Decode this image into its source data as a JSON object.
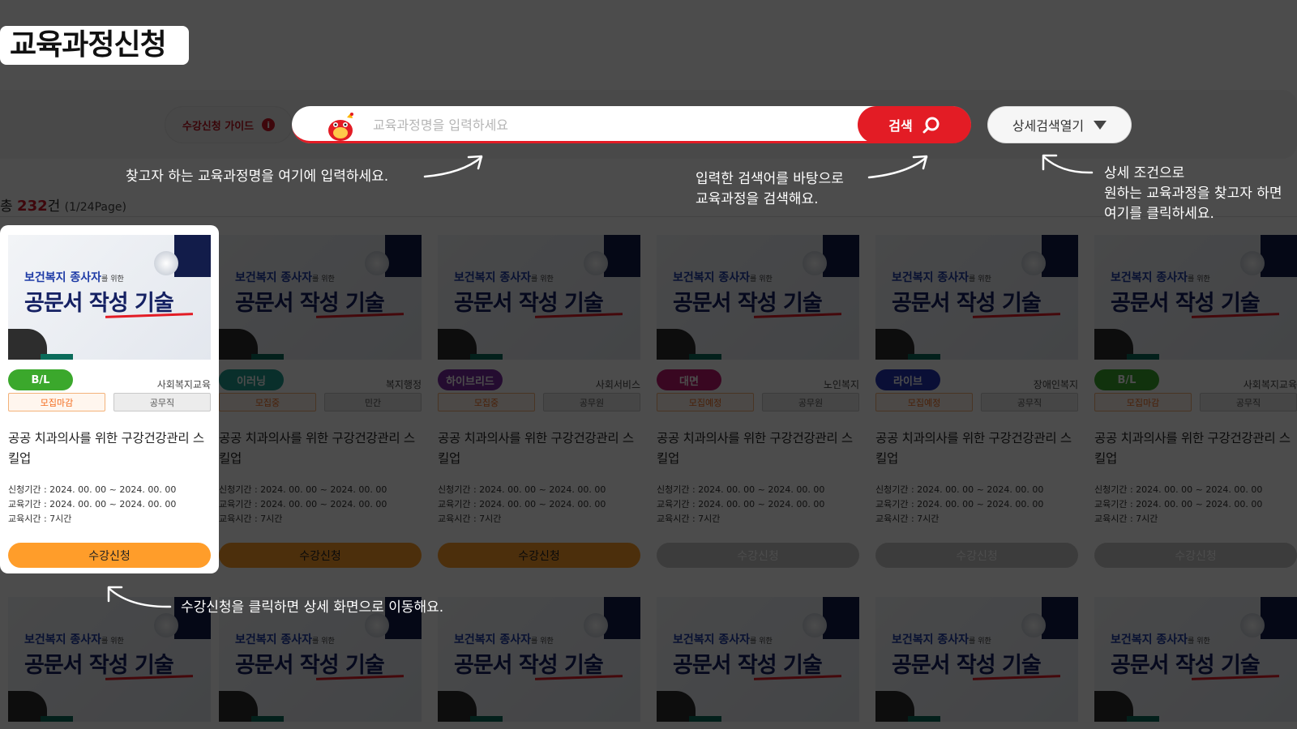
{
  "page": {
    "title": "교육과정신청"
  },
  "search": {
    "guide_label": "수강신청 가이드",
    "info_icon": "i",
    "placeholder": "교육과정명을 입력하세요",
    "search_label": "검색",
    "detail_label": "상세검색열기"
  },
  "results": {
    "prefix": "총",
    "count": "232",
    "unit": "건",
    "page_info": "(1/24Page)"
  },
  "thumbnail": {
    "line1_main": "보건복지 종사자",
    "line1_suffix": "를 위한",
    "line2": "공문서 작성 기술"
  },
  "card_labels": {
    "period_apply": "신청기간 :  2024. 00. 00 ~ 2024. 00. 00",
    "period_edu": "교육기간 :  2024. 00. 00 ~ 2024. 00. 00",
    "hours": "교육시간 : 7시간",
    "apply_button": "수강신청"
  },
  "cards": [
    {
      "type": "B/L",
      "type_color": "#3ba82c",
      "category": "사회복지교육",
      "status": "모집마감",
      "job": "공무직",
      "title": "공공 치과의사를 위한 구강건강관리 스킬업",
      "button_style": "orange"
    },
    {
      "type": "이러닝",
      "type_color": "#1f9e8f",
      "category": "복지행정",
      "status": "모집중",
      "job": "민간",
      "title": "공공 치과의사를 위한 구강건강관리 스킬업",
      "button_style": "orange"
    },
    {
      "type": "하이브리드",
      "type_color": "#7b2aa0",
      "category": "사회서비스",
      "status": "모집중",
      "job": "공무원",
      "title": "공공 치과의사를 위한 구강건강관리 스킬업",
      "button_style": "orange"
    },
    {
      "type": "대면",
      "type_color": "#c0186e",
      "category": "노인복지",
      "status": "모집예정",
      "job": "공무원",
      "title": "공공 치과의사를 위한 구강건강관리 스킬업",
      "button_style": "gray"
    },
    {
      "type": "라이브",
      "type_color": "#2232b5",
      "category": "장애인복지",
      "status": "모집예정",
      "job": "공무직",
      "title": "공공 치과의사를 위한 구강건강관리 스킬업",
      "button_style": "gray"
    },
    {
      "type": "B/L",
      "type_color": "#3ba82c",
      "category": "사회복지교육",
      "status": "모집마감",
      "job": "공무직",
      "title": "공공 치과의사를 위한 구강건강관리 스킬업",
      "button_style": "gray"
    }
  ],
  "annotations": {
    "search_input": "찾고자 하는 교육과정명을 여기에 입력하세요.",
    "search_button": [
      "입력한 검색어를 바탕으로",
      "교육과정을 검색해요."
    ],
    "detail_search": [
      "상세 조건으로",
      "원하는 교육과정을 찾고자 하면",
      "여기를 클릭하세요."
    ],
    "apply": "수강신청을 클릭하면 상세 화면으로 이동해요."
  },
  "colors": {
    "accent_red": "#e31c25",
    "apply_orange": "#ff9d2a",
    "overlay": "rgba(0,0,0,0.7)"
  }
}
